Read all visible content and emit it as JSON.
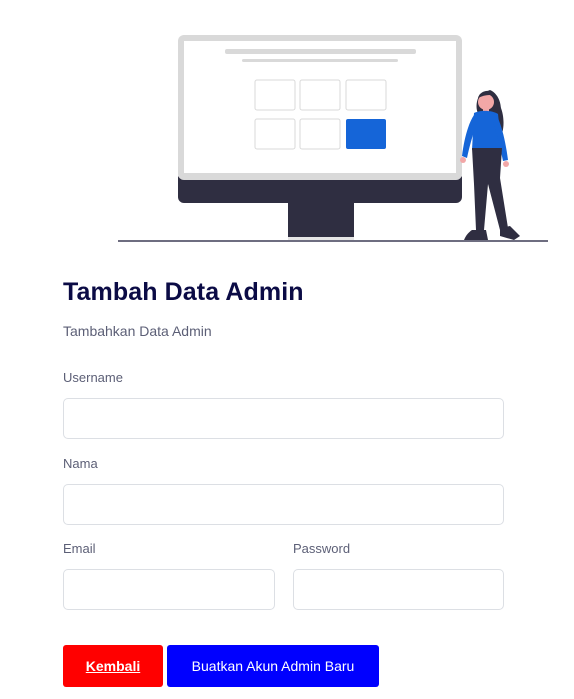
{
  "header": {
    "title": "Tambah Data Admin",
    "subtitle": "Tambahkan Data Admin"
  },
  "illustration": {
    "icon": "monitor-woman-illustration",
    "colors": {
      "monitor_frame": "#d9d9d9",
      "monitor_base": "#2f2e41",
      "accent_tile": "#1565d8",
      "shirt": "#1565d8",
      "skin": "#f2a7a7",
      "hair": "#2f2e41"
    }
  },
  "form": {
    "username": {
      "label": "Username",
      "value": "",
      "placeholder": ""
    },
    "nama": {
      "label": "Nama",
      "value": "",
      "placeholder": ""
    },
    "email": {
      "label": "Email",
      "value": "",
      "placeholder": ""
    },
    "password": {
      "label": "Password",
      "value": "",
      "placeholder": ""
    }
  },
  "actions": {
    "back_label": "Kembali",
    "create_label": "Buatkan Akun Admin Baru"
  },
  "colors": {
    "title": "#0b0b45",
    "label": "#5c5f76",
    "input_border": "#dcdfe4",
    "back_button": "#ff0000",
    "create_button": "#0000ff"
  }
}
